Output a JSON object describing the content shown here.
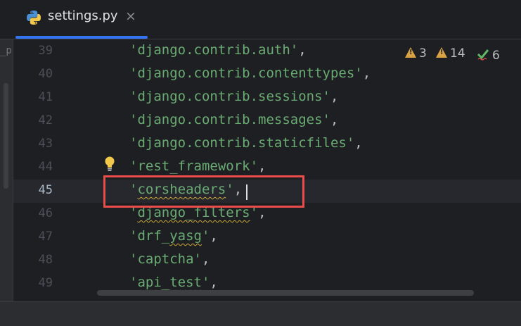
{
  "tab": {
    "filename": "settings.py",
    "close": "×"
  },
  "left_strip": {
    "label": "_p"
  },
  "inspections": {
    "errors": "3",
    "warnings": "14",
    "typos": "6",
    "error_color": "#d9a343",
    "ok_color": "#5fb865"
  },
  "editor": {
    "current_line": 45,
    "lines": [
      {
        "num": "39",
        "text": "'django.contrib.auth'",
        "punct": ","
      },
      {
        "num": "40",
        "text": "'django.contrib.contenttypes'",
        "punct": ","
      },
      {
        "num": "41",
        "text": "'django.contrib.sessions'",
        "punct": ","
      },
      {
        "num": "42",
        "text": "'django.contrib.messages'",
        "punct": ","
      },
      {
        "num": "43",
        "text": "'django.contrib.staticfiles'",
        "punct": ","
      },
      {
        "num": "44",
        "text": "'rest_framework'",
        "punct": ","
      },
      {
        "num": "45",
        "text_pre": "'",
        "text_warn": "corsheaders",
        "text_post": "'",
        "punct": ","
      },
      {
        "num": "46",
        "text_pre": "'",
        "text_warn": "django_filters",
        "text_post": "'",
        "punct": ","
      },
      {
        "num": "47",
        "text_pre": "'drf_",
        "text_warn": "yasg",
        "text_post": "'",
        "punct": ","
      },
      {
        "num": "48",
        "text": "'captcha'",
        "punct": ","
      },
      {
        "num": "49",
        "text_pre": "'",
        "text_warn": "api_test",
        "text_post": "'",
        "punct": ","
      }
    ]
  }
}
